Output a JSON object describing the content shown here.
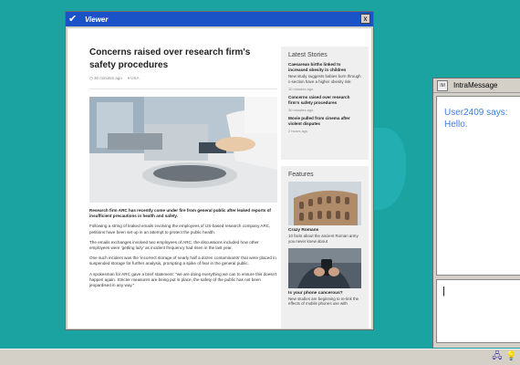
{
  "viewer": {
    "title": "Viewer",
    "close_label": "x",
    "article": {
      "headline": "Concerns raised over research firm's safety procedures",
      "time": "30 minutes ago",
      "location": "USA",
      "paragraphs": [
        "Research firm ARC has recently come under fire from general public after leaked reports of insufficient precautions in health and safety.",
        "Following a string of leaked emails involving the employees of US-based research company ARC, petitions have been set up in an attempt to protect the public health.",
        "The emails exchanges involved two employees of ARC, the discussions included how other employees were 'getting lazy' as incident frequency had risen in the last year.",
        "One such incident was the 'incorrect storage of nearly half a dozen contaminants' that were placed in suspended storage for further analysis, prompting a spike of fear in the general public.",
        "A spokesman for ARC gave a brief statement: \"we are doing everything we can to ensure this doesn't happen again. Stricter measures are being put in place, the safety of the public has not been jeopardised in any way.\""
      ]
    },
    "latest": {
      "heading": "Latest Stories",
      "stories": [
        {
          "title": "Caesarean births linked to increased obesity in children",
          "desc": "New study suggests babies born through c-section have a higher obesity risk",
          "time": "10 minutes ago"
        },
        {
          "title": "Concerns raised over research firm's safety procedures",
          "desc": "",
          "time": "30 minutes ago"
        },
        {
          "title": "Movie pulled from cinema after violent disputes",
          "desc": "",
          "time": "2 hours ago"
        }
      ]
    },
    "features": {
      "heading": "Features",
      "items": [
        {
          "title": "Crazy Romans",
          "desc": "10 facts about the ancient Roman army you never knew about"
        },
        {
          "title": "Is your phone cancerous?",
          "desc": "New studies are beginning to re-link the effects of mobile phones use with"
        }
      ]
    }
  },
  "intramessage": {
    "title": "IntraMessage",
    "icon_label": "IM",
    "sender": "User2409 says:",
    "message": "Hello.",
    "input_value": "|"
  },
  "icons": {
    "viewer": "checkmark-icon",
    "close": "close-icon",
    "clock": "clock-icon",
    "location": "location-pin-icon",
    "tray": [
      "network-icon",
      "lightbulb-icon"
    ]
  },
  "colors": {
    "desktop": "#1aa3a0",
    "viewer_titlebar": "#1a52c8",
    "message_text": "#3f7ee0"
  }
}
